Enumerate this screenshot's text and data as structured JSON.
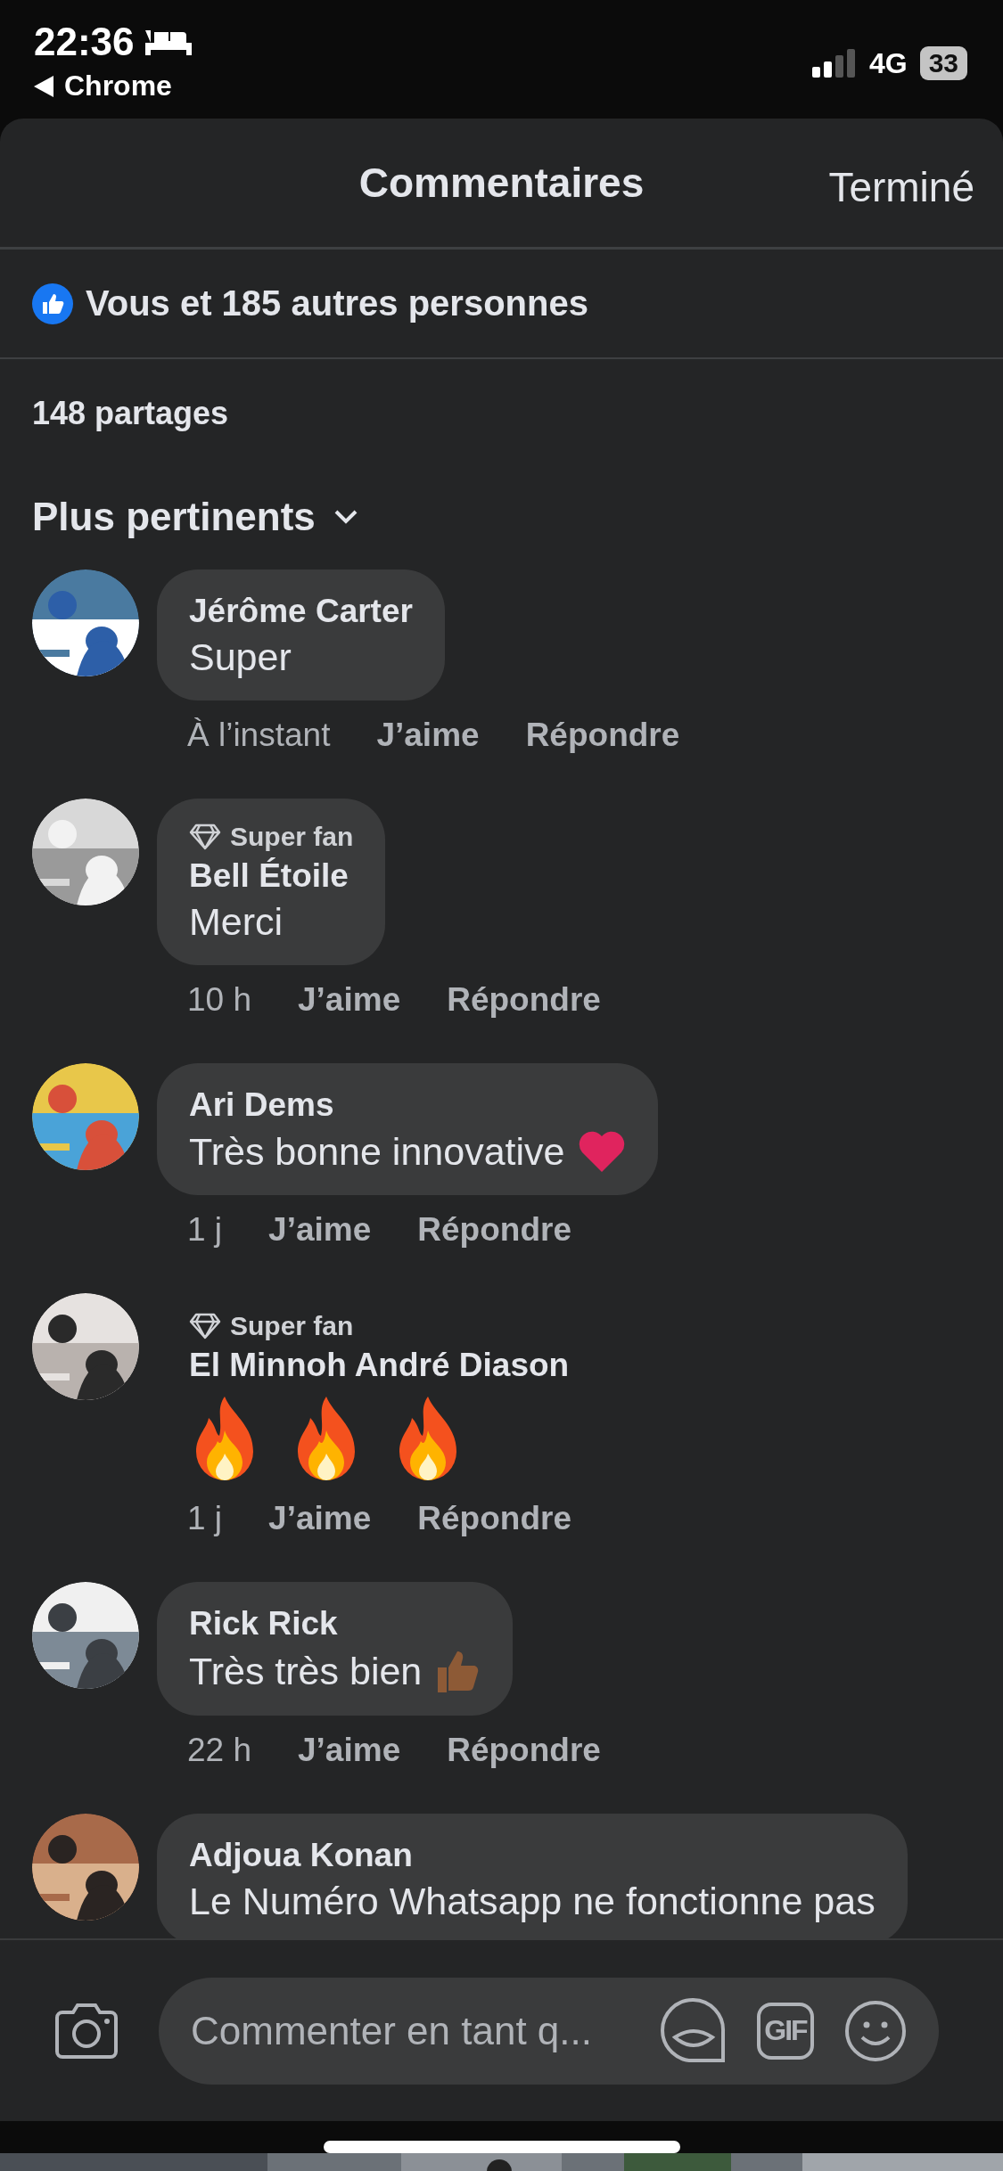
{
  "status_bar": {
    "time": "22:36",
    "back_label": "Chrome",
    "network": "4G",
    "battery": "33"
  },
  "header": {
    "title": "Commentaires",
    "done": "Terminé"
  },
  "reactions": {
    "text": "Vous et 185 autres personnes"
  },
  "shares": "148 partages",
  "sort": {
    "label": "Plus pertinents"
  },
  "comments": [
    {
      "author": "Jérôme Carter",
      "text": "Super",
      "bubble": true,
      "time": "À l’instant",
      "like": "J’aime",
      "reply": "Répondre"
    },
    {
      "badge": "Super fan",
      "author": "Bell Étoile",
      "text": "Merci",
      "bubble": true,
      "time": "10 h",
      "like": "J’aime",
      "reply": "Répondre"
    },
    {
      "author": "Ari Dems",
      "text": "Très bonne innovative",
      "emoji": [
        {
          "kind": "heart"
        }
      ],
      "bubble": true,
      "time": "1 j",
      "like": "J’aime",
      "reply": "Répondre"
    },
    {
      "badge": "Super fan",
      "author": "El Minnoh André Diason",
      "emoji": [
        {
          "kind": "fire"
        },
        {
          "kind": "fire"
        },
        {
          "kind": "fire"
        }
      ],
      "bubble": false,
      "time": "1 j",
      "like": "J’aime",
      "reply": "Répondre"
    },
    {
      "author": "Rick Rick",
      "text": "Très très bien",
      "emoji": [
        {
          "kind": "thumbs"
        }
      ],
      "bubble": true,
      "time": "22 h",
      "like": "J’aime",
      "reply": "Répondre"
    },
    {
      "author": "Adjoua Konan",
      "text": "Le Numéro Whatsapp ne fonctionne pas",
      "bubble": true
    }
  ],
  "composer": {
    "placeholder": "Commenter en tant q...",
    "gif_label": "GIF"
  }
}
